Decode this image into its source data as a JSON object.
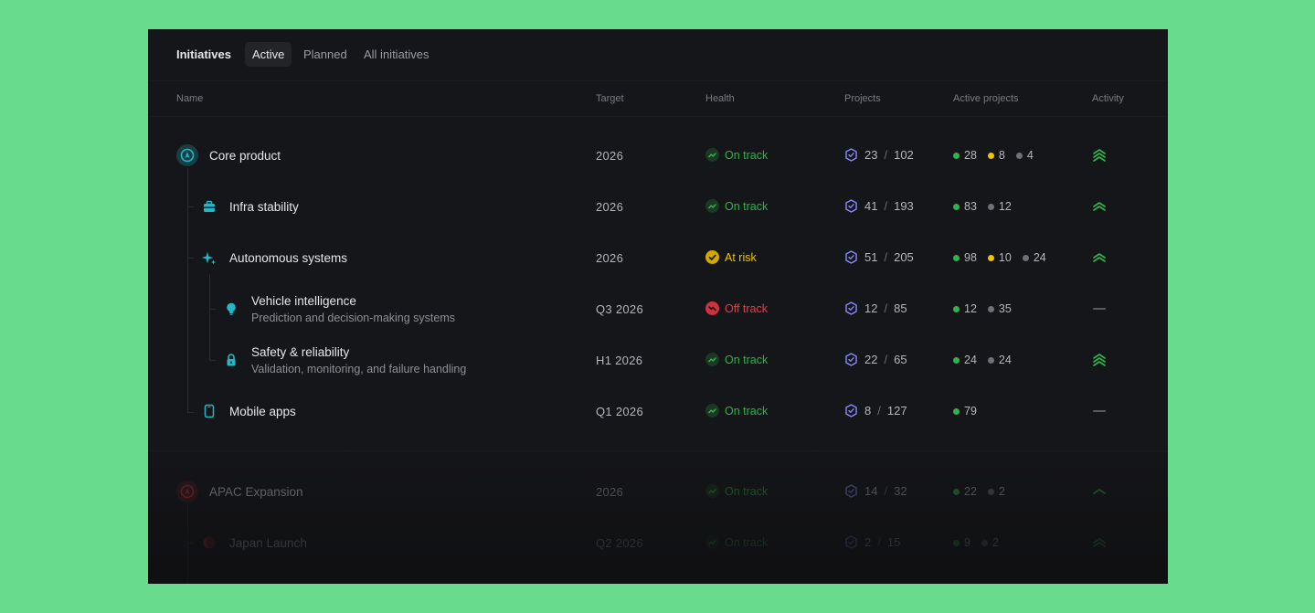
{
  "header": {
    "title": "Initiatives",
    "tabs": [
      {
        "label": "Active",
        "active": true
      },
      {
        "label": "Planned",
        "active": false
      },
      {
        "label": "All initiatives",
        "active": false
      }
    ]
  },
  "columns": {
    "name": "Name",
    "target": "Target",
    "health": "Health",
    "projects": "Projects",
    "active_projects": "Active projects",
    "activity": "Activity"
  },
  "colors": {
    "on_track": "#2fb34a",
    "at_risk": "#f2c300",
    "off_track": "#eb3a46",
    "grey_dot": "#6f7178",
    "project_icon": "#8b87ff",
    "icon_teal": "#22b7c9",
    "icon_red": "#d8323c"
  },
  "rows": [
    {
      "name": "Core product",
      "sub": "",
      "icon": "rocket-icon",
      "target": "2026",
      "health": "On track",
      "health_state": "on_track",
      "projects_done": "23",
      "projects_total": "102",
      "active": [
        {
          "state": "on_track",
          "count": "28"
        },
        {
          "state": "at_risk",
          "count": "8"
        },
        {
          "state": "grey",
          "count": "4"
        }
      ],
      "activity": "high"
    },
    {
      "name": "Infra stability",
      "sub": "",
      "icon": "toolbox-icon",
      "target": "2026",
      "health": "On track",
      "health_state": "on_track",
      "projects_done": "41",
      "projects_total": "193",
      "active": [
        {
          "state": "on_track",
          "count": "83"
        },
        {
          "state": "grey",
          "count": "12"
        }
      ],
      "activity": "medium"
    },
    {
      "name": "Autonomous systems",
      "sub": "",
      "icon": "sparkle-icon",
      "target": "2026",
      "health": "At risk",
      "health_state": "at_risk",
      "projects_done": "51",
      "projects_total": "205",
      "active": [
        {
          "state": "on_track",
          "count": "98"
        },
        {
          "state": "at_risk",
          "count": "10"
        },
        {
          "state": "grey",
          "count": "24"
        }
      ],
      "activity": "medium"
    },
    {
      "name": "Vehicle intelligence",
      "sub": "Prediction and decision-making systems",
      "icon": "lightbulb-icon",
      "target": "Q3 2026",
      "health": "Off track",
      "health_state": "off_track",
      "projects_done": "12",
      "projects_total": "85",
      "active": [
        {
          "state": "on_track",
          "count": "12"
        },
        {
          "state": "grey",
          "count": "35"
        }
      ],
      "activity": "none"
    },
    {
      "name": "Safety & reliability",
      "sub": "Validation, monitoring, and failure handling",
      "icon": "lock-icon",
      "target": "H1 2026",
      "health": "On track",
      "health_state": "on_track",
      "projects_done": "22",
      "projects_total": "65",
      "active": [
        {
          "state": "on_track",
          "count": "24"
        },
        {
          "state": "grey",
          "count": "24"
        }
      ],
      "activity": "high"
    },
    {
      "name": "Mobile apps",
      "sub": "",
      "icon": "phone-icon",
      "target": "Q1 2026",
      "health": "On track",
      "health_state": "on_track",
      "projects_done": "8",
      "projects_total": "127",
      "active": [
        {
          "state": "on_track",
          "count": "79"
        }
      ],
      "activity": "none"
    },
    {
      "name": "APAC Expansion",
      "sub": "",
      "icon": "rocket-icon",
      "target": "2026",
      "health": "On track",
      "health_state": "on_track",
      "projects_done": "14",
      "projects_total": "32",
      "active": [
        {
          "state": "on_track",
          "count": "22"
        },
        {
          "state": "grey",
          "count": "2"
        }
      ],
      "activity": "low"
    },
    {
      "name": "Japan Launch",
      "sub": "",
      "icon": "globe-icon",
      "target": "Q2 2026",
      "health": "On track",
      "health_state": "on_track",
      "projects_done": "2",
      "projects_total": "15",
      "active": [
        {
          "state": "on_track",
          "count": "9"
        },
        {
          "state": "grey",
          "count": "2"
        }
      ],
      "activity": "medium"
    }
  ]
}
